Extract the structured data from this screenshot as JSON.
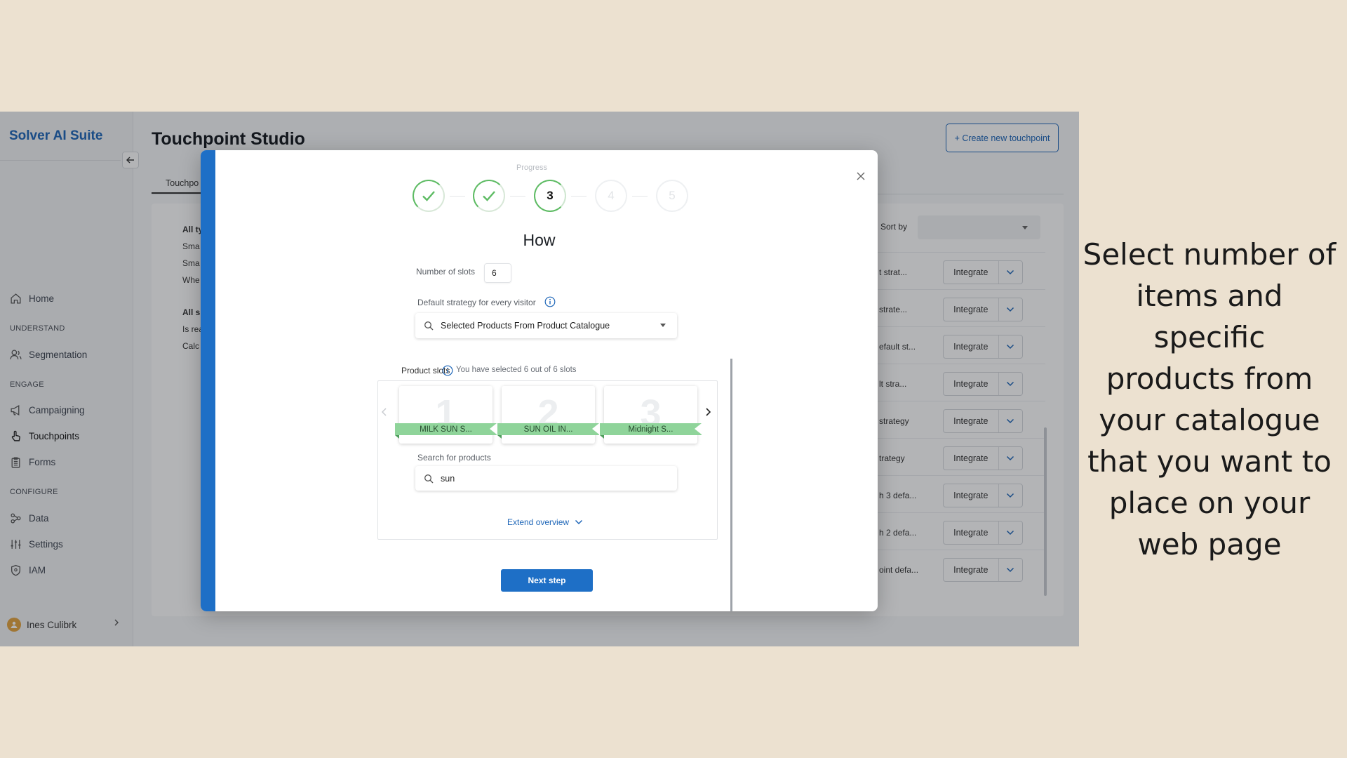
{
  "app": {
    "brand": "Solver AI Suite",
    "page_title": "Touchpoint Studio",
    "create_button": "+ Create new touchpoint",
    "tab_label": "Touchpo",
    "sort_by_label": "Sort by"
  },
  "sidebar": {
    "home": "Home",
    "section_understand": "UNDERSTAND",
    "segmentation": "Segmentation",
    "section_engage": "ENGAGE",
    "campaigning": "Campaigning",
    "touchpoints": "Touchpoints",
    "forms": "Forms",
    "section_configure": "CONFIGURE",
    "data": "Data",
    "settings": "Settings",
    "iam": "IAM",
    "user_name": "Ines Culibrk"
  },
  "filters": {
    "f1": "All ty",
    "f2": "Sma",
    "f3": "Sma",
    "f4": "Whe",
    "f5": "All s",
    "f6": "Is rea",
    "f7": "Calc"
  },
  "rows": [
    {
      "name": "t strat...",
      "action": "Integrate"
    },
    {
      "name": "strate...",
      "action": "Integrate"
    },
    {
      "name": "efault st...",
      "action": "Integrate"
    },
    {
      "name": "lt stra...",
      "action": "Integrate"
    },
    {
      "name": "strategy",
      "action": "Integrate"
    },
    {
      "name": "trategy",
      "action": "Integrate"
    },
    {
      "name": "h 3 defa...",
      "action": "Integrate"
    },
    {
      "name": "h 2 defa...",
      "action": "Integrate"
    },
    {
      "name": "oint defa...",
      "action": "Integrate"
    }
  ],
  "modal": {
    "progress_label": "Progress",
    "steps": [
      "1",
      "2",
      "3",
      "4",
      "5"
    ],
    "current_step": 3,
    "title": "How",
    "slots_label": "Number of slots",
    "slots_value": "6",
    "strategy_label": "Default strategy for every visitor",
    "strategy_value": "Selected Products From Product Catalogue",
    "product_slots_label": "Product slots",
    "slots_selected_text": "You have selected 6 out of 6 slots",
    "cards": [
      {
        "num": "1",
        "product": "MILK SUN S..."
      },
      {
        "num": "2",
        "product": "SUN OIL IN..."
      },
      {
        "num": "3",
        "product": "Midnight S..."
      }
    ],
    "search_label": "Search for products",
    "search_value": "sun",
    "extend_label": "Extend overview",
    "next_button": "Next step"
  },
  "caption": {
    "line1": "Select number of",
    "line2": "items and specific",
    "line3": "products from",
    "line4": "your catalogue",
    "line5": "that you want to",
    "line6": "place on your",
    "line7": "web page"
  },
  "colors": {
    "background": "#ece1d0",
    "brand_blue": "#1e66b8",
    "modal_stripe": "#1e6fc6",
    "progress_green": "#5dbb63",
    "ribbon_green": "#8fd49a"
  }
}
